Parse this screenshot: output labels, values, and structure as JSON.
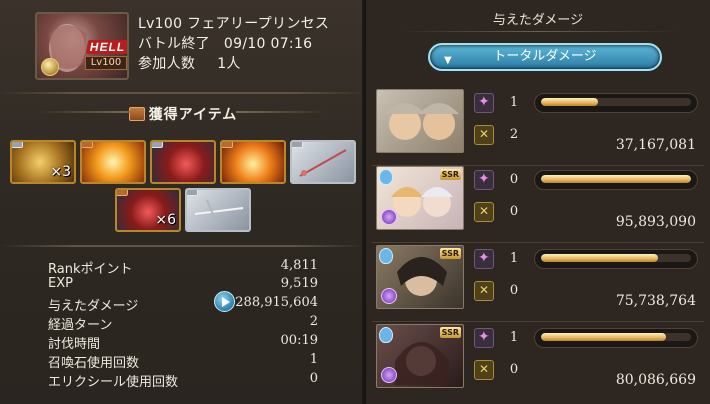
{
  "quest": {
    "difficulty": "HELL",
    "level_badge": "Lv100",
    "name": "Lv100 フェアリープリンセス",
    "battle_end_label": "バトル終了",
    "battle_end_value": "09/10 07:16",
    "participants_label": "参加人数",
    "participants_value": "1人"
  },
  "items_section": {
    "title": "獲得アイテム",
    "items": [
      {
        "name": "gold-medal-item",
        "count": "×3"
      },
      {
        "name": "fire-orb-item",
        "count": ""
      },
      {
        "name": "red-crystal-item",
        "count": ""
      },
      {
        "name": "flame-crest-item",
        "count": ""
      },
      {
        "name": "silver-weapon-item",
        "count": ""
      },
      {
        "name": "red-crystal-item",
        "count": "×6"
      },
      {
        "name": "silver-weapon-item",
        "count": ""
      }
    ]
  },
  "stats": [
    {
      "label": "Rankポイント",
      "value": "4,811"
    },
    {
      "label": "EXP",
      "value": "9,519"
    },
    {
      "label": "与えたダメージ",
      "value": "288,915,604"
    },
    {
      "label": "経過ターン",
      "value": "2"
    },
    {
      "label": "討伐時間",
      "value": "00:19"
    },
    {
      "label": "召喚石使用回数",
      "value": "1"
    },
    {
      "label": "エリクシール使用回数",
      "value": "0"
    }
  ],
  "damage_panel": {
    "title": "与えたダメージ",
    "dropdown": "トータルダメージ",
    "rows": [
      {
        "star": "1",
        "ox": "2",
        "damage": "37,167,081",
        "fill": 0.38
      },
      {
        "star": "0",
        "ox": "0",
        "damage": "95,893,090",
        "fill": 1.0
      },
      {
        "star": "1",
        "ox": "0",
        "damage": "75,738,764",
        "fill": 0.78
      },
      {
        "star": "1",
        "ox": "0",
        "damage": "80,086,669",
        "fill": 0.83
      }
    ]
  }
}
